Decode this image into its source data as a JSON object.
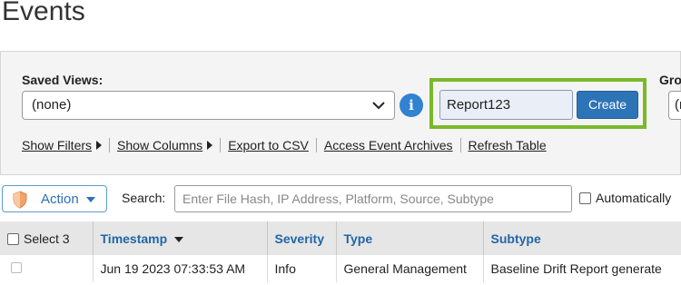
{
  "page": {
    "title": "Events"
  },
  "filters": {
    "saved_views_label": "Saved Views:",
    "saved_views_value": "(none)",
    "report_name_value": "Report123",
    "create_label": "Create",
    "group_label": "Gro",
    "group_value": "(n"
  },
  "links": {
    "show_filters": "Show Filters",
    "show_columns": "Show Columns",
    "export_csv": "Export to CSV",
    "access_archives": "Access Event Archives",
    "refresh_table": "Refresh Table"
  },
  "toolbar": {
    "action_label": "Action",
    "search_label": "Search:",
    "search_placeholder": "Enter File Hash, IP Address, Platform, Source, Subtype",
    "auto_label": "Automatically"
  },
  "table": {
    "select_label": "Select 3",
    "columns": [
      "Timestamp",
      "Severity",
      "Type",
      "Subtype"
    ],
    "rows": [
      {
        "timestamp": "Jun 19 2023 07:33:53 AM",
        "severity": "Info",
        "type": "General Management",
        "subtype": "Baseline Drift Report generate"
      }
    ]
  },
  "colors": {
    "accent": "#2d74b7",
    "highlight": "#7ab929",
    "header_link": "#2166a8"
  }
}
